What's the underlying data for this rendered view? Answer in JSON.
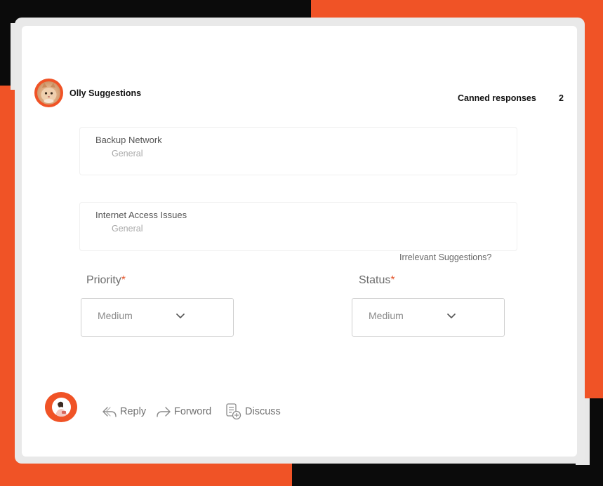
{
  "header": {
    "title": "Olly Suggestions",
    "canned_label": "Canned responses",
    "canned_count": "2"
  },
  "suggestions": [
    {
      "title": "Backup Network",
      "category": "General"
    },
    {
      "title": "Internet Access Issues",
      "category": "General"
    }
  ],
  "irrelevant_link": "Irrelevant Suggestions?",
  "fields": {
    "priority": {
      "label": "Priority",
      "required_mark": "*",
      "value": "Medium"
    },
    "status": {
      "label": "Status",
      "required_mark": "*",
      "value": "Medium"
    }
  },
  "actions": {
    "reply": "Reply",
    "forward": "Forword",
    "discuss": "Discuss"
  },
  "colors": {
    "accent": "#f05326",
    "backdrop_dark": "#0b0b0b",
    "card_frame": "#e9e9e9",
    "required": "#e4572e"
  },
  "icons": [
    "cat-avatar",
    "user-avatar",
    "chevron-down-icon",
    "reply-icon",
    "forward-icon",
    "discuss-icon"
  ]
}
